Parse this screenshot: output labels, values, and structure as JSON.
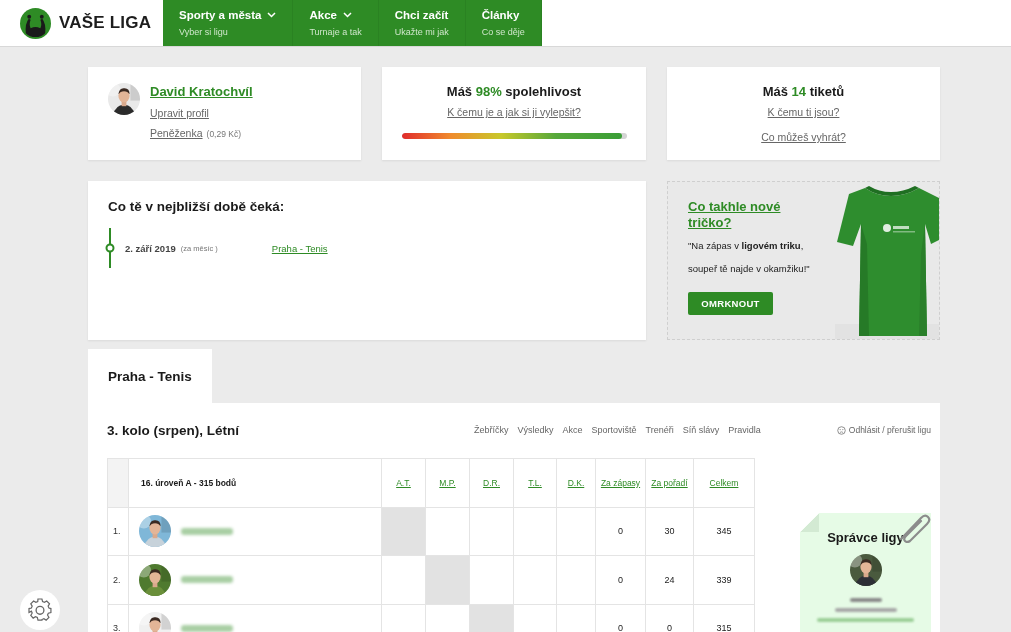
{
  "header": {
    "logo_text": "VAŠE LIGA",
    "nav": [
      {
        "label": "Sporty a města",
        "sublabel": "Vyber si ligu",
        "dropdown": true
      },
      {
        "label": "Akce",
        "sublabel": "Turnaje a tak",
        "dropdown": true
      },
      {
        "label": "Chci začít",
        "sublabel": "Ukažte mi jak",
        "dropdown": false
      },
      {
        "label": "Články",
        "sublabel": "Co se děje",
        "dropdown": false
      }
    ]
  },
  "profile_card": {
    "name": "David Kratochvíl",
    "edit_link": "Upravit profil",
    "wallet_link": "Peněženka",
    "wallet_amount": "(0,29 Kč)"
  },
  "reliability_card": {
    "title": "Máš **98%** spolehlivost",
    "link": "K čemu je a jak si ji vylepšit?",
    "level": 0.98
  },
  "tickets_card": {
    "title": "Máš **14** tiketů",
    "links": [
      "K čemu ti jsou?",
      "Co můžeš vyhrát?"
    ]
  },
  "upcoming": {
    "heading": "Co tě v nejbližší době čeká:",
    "events": [
      {
        "date": "2. září 2019",
        "relative": "(za měsíc )",
        "link": "Praha - Tenis"
      }
    ]
  },
  "promo": {
    "title": "Co takhle nové tričko?",
    "quote_lines": [
      "\"Na zápas v **ligovém triku**,",
      "soupeř tě najde v okamžiku!\""
    ],
    "button": "OMRKNOUT"
  },
  "tabs": [
    {
      "label": "Praha - Tenis",
      "selected": true
    }
  ],
  "league": {
    "heading": "3. kolo (srpen), Létní",
    "links": [
      "Žebříčky",
      "Výsledky",
      "Akce",
      "Sportoviště",
      "Trenéři",
      "Síň slávy",
      "Pravidla"
    ],
    "leave_link": "Odhlásit / přerušit ligu",
    "table": {
      "columns": [
        {
          "label": "16. úroveň A - 315 bodů",
          "kind": "title"
        },
        {
          "label": "A.T.",
          "kind": "link"
        },
        {
          "label": "M.P.",
          "kind": "link"
        },
        {
          "label": "D.R.",
          "kind": "link"
        },
        {
          "label": "T.L.",
          "kind": "link"
        },
        {
          "label": "D.K.",
          "kind": "link"
        },
        {
          "label": "Za zápasy",
          "kind": "link"
        },
        {
          "label": "Za pořadí",
          "kind": "link"
        },
        {
          "label": "Celkem",
          "kind": "link"
        }
      ],
      "rows": [
        {
          "rank": "1.",
          "shaded": [
            true,
            false,
            false,
            false,
            false
          ],
          "scores": [
            "0",
            "30",
            "345"
          ]
        },
        {
          "rank": "2.",
          "shaded": [
            false,
            true,
            false,
            false,
            false
          ],
          "scores": [
            "0",
            "24",
            "339"
          ]
        },
        {
          "rank": "3.",
          "shaded": [
            false,
            false,
            true,
            false,
            false
          ],
          "scores": [
            "0",
            "0",
            "315"
          ]
        }
      ]
    }
  },
  "manager": {
    "title": "Správce ligy"
  }
}
